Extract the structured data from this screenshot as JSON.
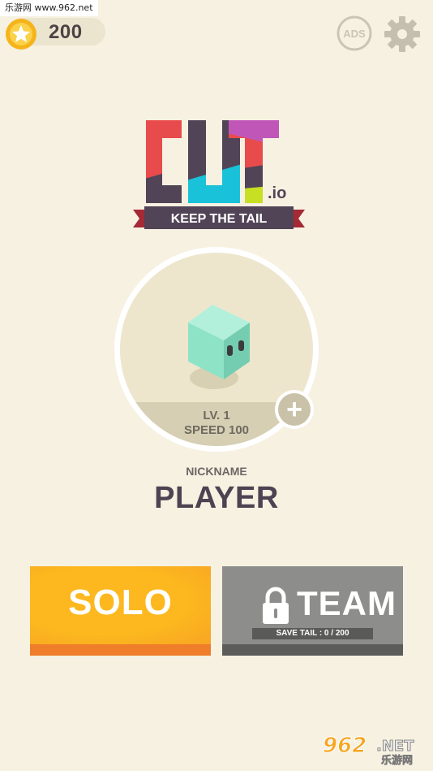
{
  "watermark": "乐游网 www.962.net",
  "header": {
    "coins": "200",
    "ads_label": "ADS"
  },
  "logo": {
    "word": "CUT",
    "suffix": ".io",
    "tagline": "KEEP THE TAIL",
    "colors": [
      "#e84b4b",
      "#514457",
      "#19c2d8",
      "#c057b8",
      "#c7e024"
    ]
  },
  "character": {
    "level": "LV. 1",
    "speed": "SPEED 100",
    "cube_color": "#8ee3c7"
  },
  "nickname": {
    "label": "NICKNAME",
    "value": "PLAYER"
  },
  "modes": {
    "solo_label": "SOLO",
    "team_label": "TEAM",
    "save_tail": "SAVE TAIL : 0 / 200"
  },
  "brand": {
    "number": "962",
    "suffix": ".NET",
    "chinese": "乐游网"
  }
}
